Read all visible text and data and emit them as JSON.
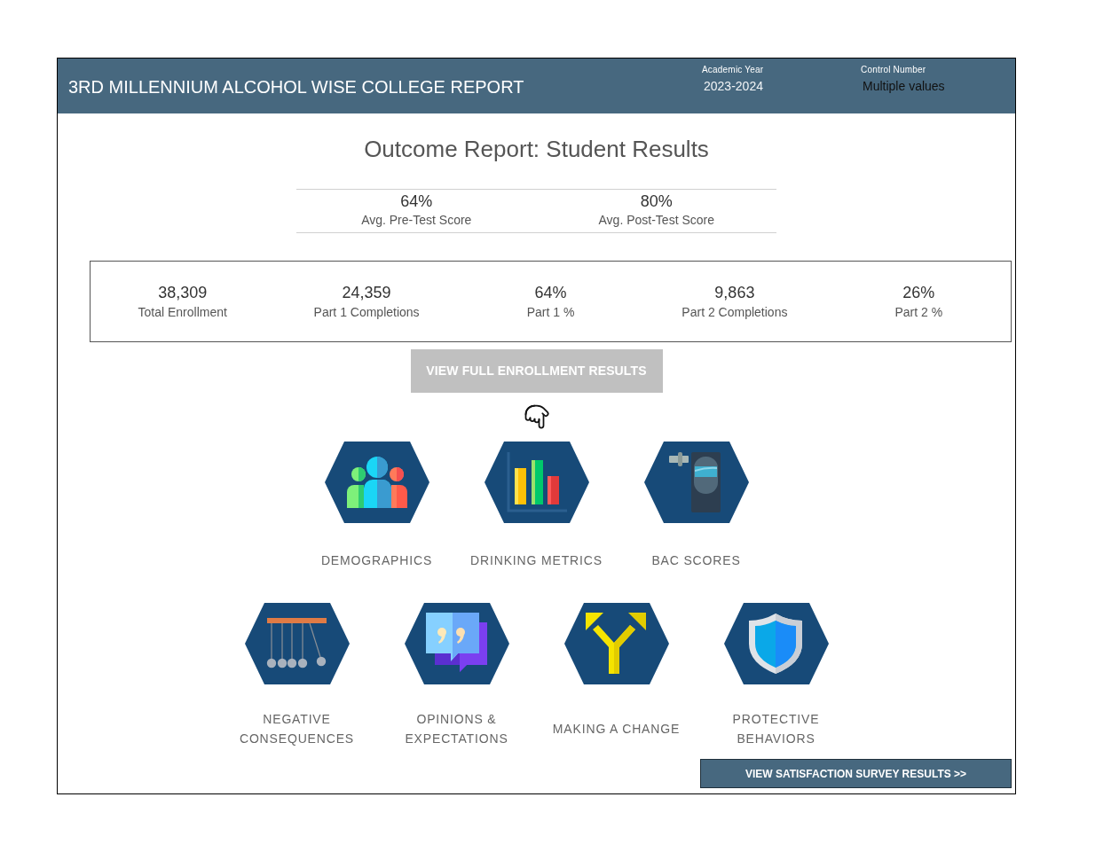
{
  "header": {
    "title": "3RD MILLENNIUM ALCOHOL WISE COLLEGE REPORT",
    "filters": [
      {
        "label": "Academic Year",
        "value": "2023-2024"
      },
      {
        "label": "Control Number",
        "value": "Multiple values"
      }
    ]
  },
  "report_title": "Outcome Report: Student Results",
  "test_scores": [
    {
      "value": "64%",
      "label": "Avg. Pre-Test Score"
    },
    {
      "value": "80%",
      "label": "Avg. Post-Test Score"
    }
  ],
  "enrollment_stats": [
    {
      "value": "38,309",
      "label": "Total Enrollment"
    },
    {
      "value": "24,359",
      "label": "Part 1 Completions"
    },
    {
      "value": "64%",
      "label": "Part 1 %"
    },
    {
      "value": "9,863",
      "label": "Part 2 Completions"
    },
    {
      "value": "26%",
      "label": "Part 2 %"
    }
  ],
  "enrollment_button": "VIEW FULL ENROLLMENT RESULTS",
  "topic_rows": [
    [
      {
        "kind": "demographics",
        "label": "DEMOGRAPHICS"
      },
      {
        "kind": "metrics",
        "label": "DRINKING METRICS"
      },
      {
        "kind": "bac",
        "label": "BAC SCORES"
      }
    ],
    [
      {
        "kind": "consequences",
        "label": "NEGATIVE CONSEQUENCES"
      },
      {
        "kind": "opinions",
        "label": "OPINIONS & EXPECTATIONS"
      },
      {
        "kind": "change",
        "label": "MAKING A CHANGE"
      },
      {
        "kind": "protective",
        "label": "PROTECTIVE BEHAVIORS"
      }
    ]
  ],
  "survey_button": "VIEW SATISFACTION SURVEY RESULTS >>"
}
